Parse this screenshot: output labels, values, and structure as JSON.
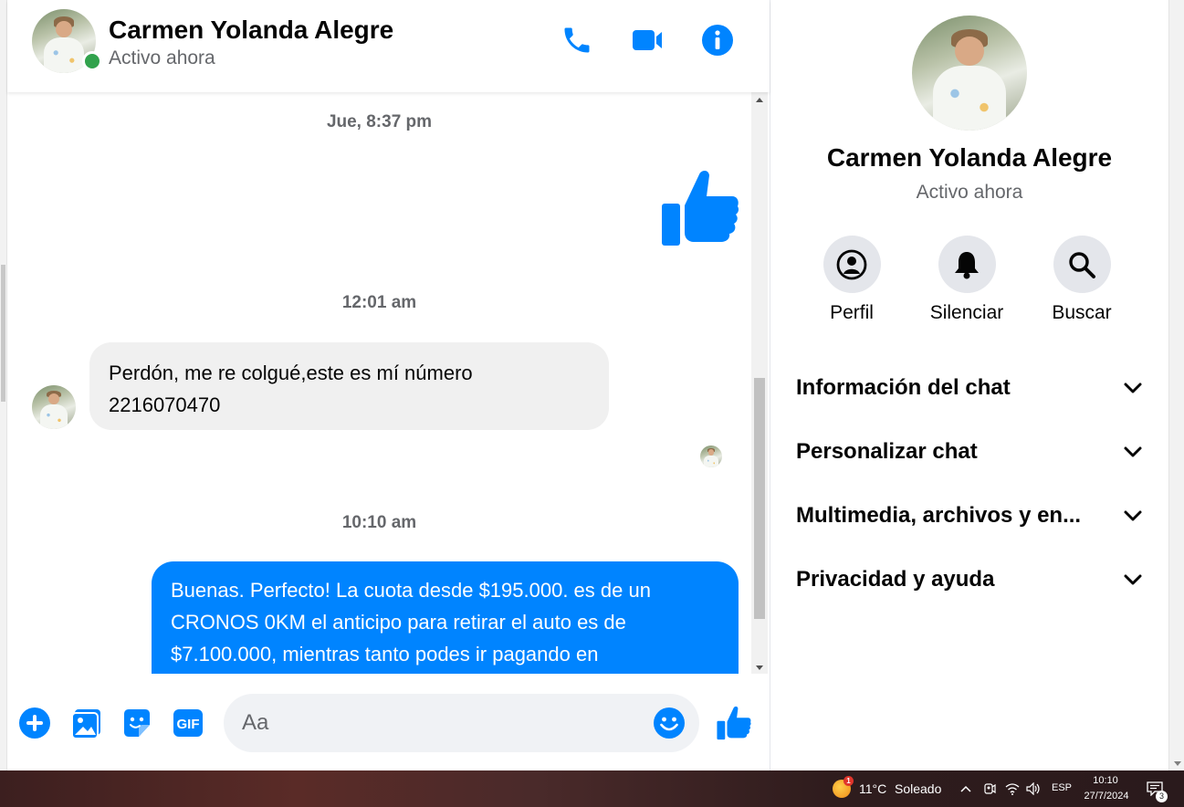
{
  "header": {
    "name": "Carmen Yolanda Alegre",
    "status": "Activo ahora",
    "icons": [
      "phone-icon",
      "video-camera-icon",
      "info-icon"
    ]
  },
  "messages": {
    "timestamps": [
      "Jue, 8:37 pm",
      "12:01 am",
      "10:10 am"
    ],
    "incoming": "Perdón, me re colgué,este es mí número 2216070470",
    "outgoing": "Buenas. Perfecto! La cuota desde $195.000. es de un CRONOS 0KM el anticipo para retirar el auto es de $7.100.000, mientras tanto podes ir pagando en"
  },
  "composer": {
    "placeholder": "Aa",
    "icons": [
      "plus-icon",
      "image-icon",
      "sticker-icon",
      "gif-icon",
      "emoji-icon",
      "thumbs-up-icon"
    ],
    "gif_label": "GIF"
  },
  "panel": {
    "name": "Carmen Yolanda Alegre",
    "status": "Activo ahora",
    "actions": [
      {
        "label": "Perfil",
        "icon": "profile-icon"
      },
      {
        "label": "Silenciar",
        "icon": "bell-icon"
      },
      {
        "label": "Buscar",
        "icon": "search-icon"
      }
    ],
    "sections": [
      {
        "label": "Información del chat"
      },
      {
        "label": "Personalizar chat"
      },
      {
        "label": "Multimedia, archivos y en..."
      },
      {
        "label": "Privacidad y ayuda"
      }
    ]
  },
  "taskbar": {
    "weather_badge": "1",
    "temperature": "11°C",
    "weather": "Soleado",
    "language": "ESP",
    "time": "10:10",
    "date": "27/7/2024",
    "notifications": "3"
  },
  "colors": {
    "accent": "#0084ff",
    "online": "#31a24c",
    "incoming_bubble": "#f0f0f0",
    "secondary_text": "#65676b"
  }
}
